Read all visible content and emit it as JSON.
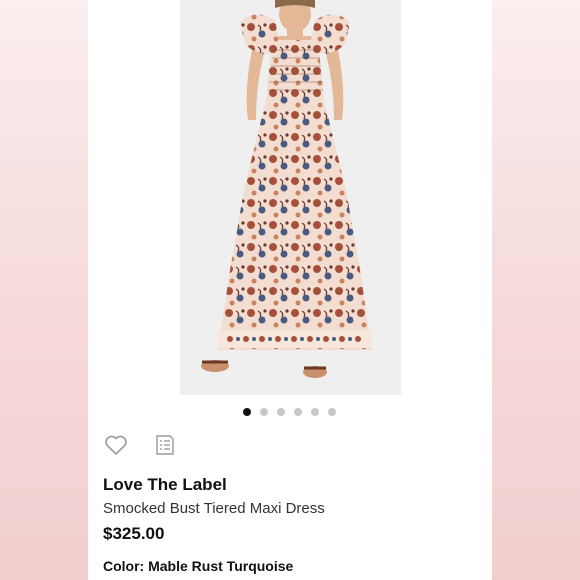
{
  "product": {
    "brand": "Love The Label",
    "title": "Smocked Bust Tiered Maxi Dress",
    "price": "$325.00",
    "color_label": "Color:",
    "color_value": "Mable Rust Turquoise"
  },
  "carousel": {
    "total_images": 6,
    "active_index": 0
  },
  "icons": {
    "favorite": "heart-icon",
    "details": "list-icon"
  },
  "colors": {
    "side_background": "#f4d6d6",
    "dress_base": "#f3ddd0",
    "print_rust": "#a5503a",
    "print_navy": "#4b5a80"
  }
}
